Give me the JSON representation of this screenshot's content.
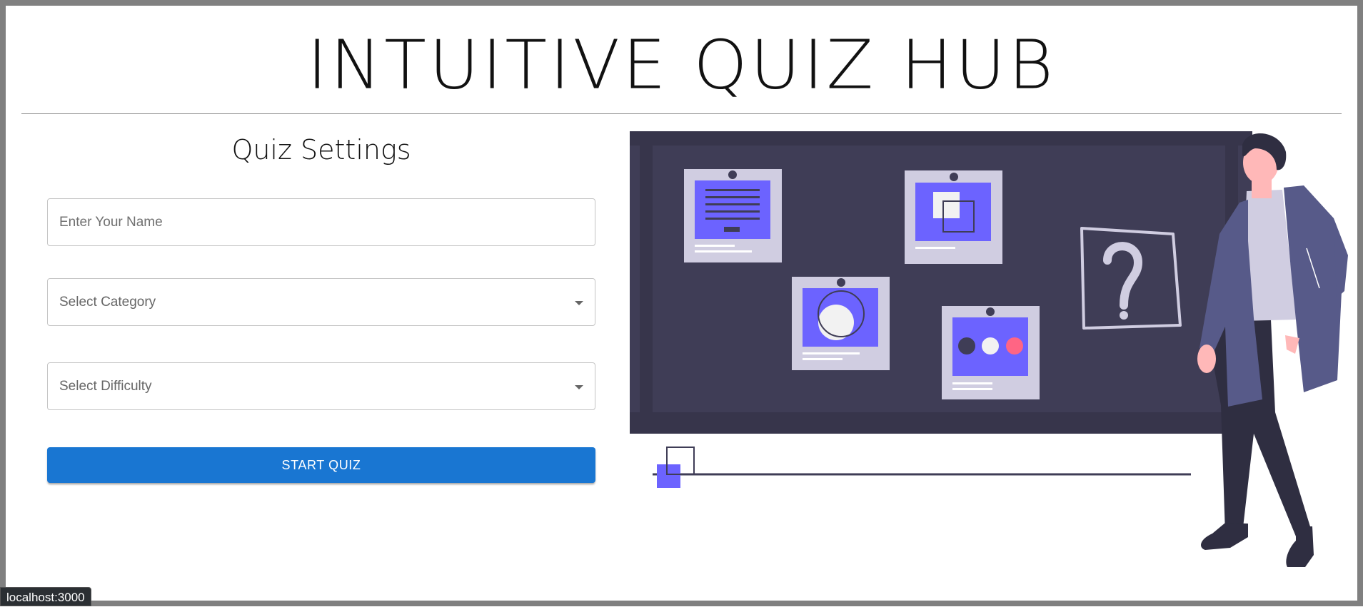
{
  "app": {
    "title": "INTUITIVE QUIZ HUB"
  },
  "settings": {
    "heading": "Quiz Settings",
    "name_placeholder": "Enter Your Name",
    "name_value": "",
    "category_placeholder": "Select Category",
    "difficulty_placeholder": "Select Difficulty",
    "start_label": "START QUIZ"
  },
  "illustration": {
    "question_mark": "?"
  },
  "status_bar": {
    "url": "localhost:3000"
  },
  "colors": {
    "primary": "#1976d2",
    "board": "#3f3d56",
    "accent": "#6c63ff",
    "card": "#d0cde1",
    "pink": "#ff6584",
    "skin": "#ffb8b8",
    "coat": "#575a89"
  }
}
